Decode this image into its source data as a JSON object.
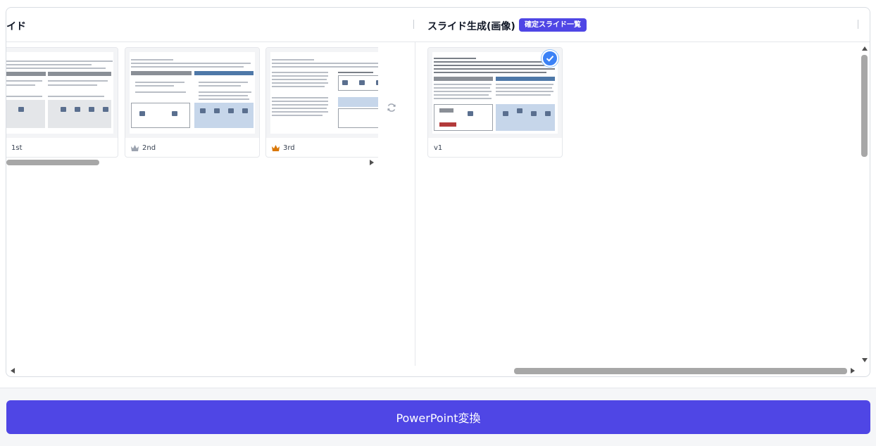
{
  "header": {
    "left_title": "スライド",
    "right_title": "スライド生成(画像)",
    "badge": "確定スライド一覧"
  },
  "left_panel": {
    "cards": [
      {
        "label": "1st",
        "rank_icon": "crown-icon",
        "crown_color": "#9ca3af"
      },
      {
        "label": "2nd",
        "rank_icon": "crown-icon",
        "crown_color": "#9ca3af"
      },
      {
        "label": "3rd",
        "rank_icon": "crown-icon",
        "crown_color": "#d97706"
      }
    ]
  },
  "right_panel": {
    "cards": [
      {
        "label": "v1",
        "selected": true
      }
    ]
  },
  "footer": {
    "convert_button": "PowerPoint変換"
  },
  "colors": {
    "accent": "#4f46e5",
    "check": "#3b82f6"
  }
}
